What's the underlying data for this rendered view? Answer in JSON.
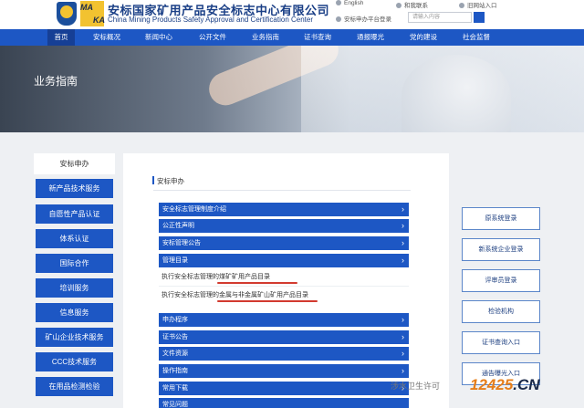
{
  "header": {
    "logo_text": [
      "MA",
      "KA"
    ],
    "org_name_cn": "安标国家矿用产品安全标志中心有限公司",
    "org_name_en": "China Mining Products Safety Approval and Certification Center",
    "links": {
      "english": "English",
      "contact": "和我联系",
      "old_site": "旧网站入口",
      "platform_login": "安标申办平台登录"
    },
    "search_placeholder": "请输入内容"
  },
  "nav": {
    "items": [
      "首页",
      "安标概况",
      "新闻中心",
      "公开文件",
      "业务指南",
      "证书查询",
      "通报曝光",
      "党的建设",
      "社会监督"
    ],
    "active": "首页"
  },
  "banner": {
    "title": "业务指南"
  },
  "sidebar": {
    "heading": "安标申办",
    "items": [
      "新产品技术服务",
      "自愿性产品认证",
      "体系认证",
      "国际合作",
      "培训服务",
      "信息服务",
      "矿山企业技术服务",
      "CCC技术服务",
      "在用品检测检验"
    ]
  },
  "main": {
    "title": "安标申办",
    "accordion_top": [
      "安全标志管理制度介绍",
      "公正性声明",
      "安标管理公告",
      "管理目录"
    ],
    "sub_items": [
      "执行安全标志管理的煤矿矿用产品目录",
      "执行安全标志管理的金属与非金属矿山矿用产品目录"
    ],
    "accordion_bottom": [
      "申办程序",
      "证书公告",
      "文件资源",
      "操作指南",
      "常用下载",
      "常见问题"
    ]
  },
  "right_buttons": [
    "原系统登录",
    "新系统企业登录",
    "评审员登录",
    "检验机构",
    "证书查询入口",
    "通告曝光入口"
  ],
  "watermark": {
    "text": "涉水卫生许可",
    "big": "12425",
    "big_suffix": ".CN"
  },
  "colors": {
    "primary": "#1d57c4",
    "nav_active": "#163f95",
    "underline": "#d23a2f"
  }
}
